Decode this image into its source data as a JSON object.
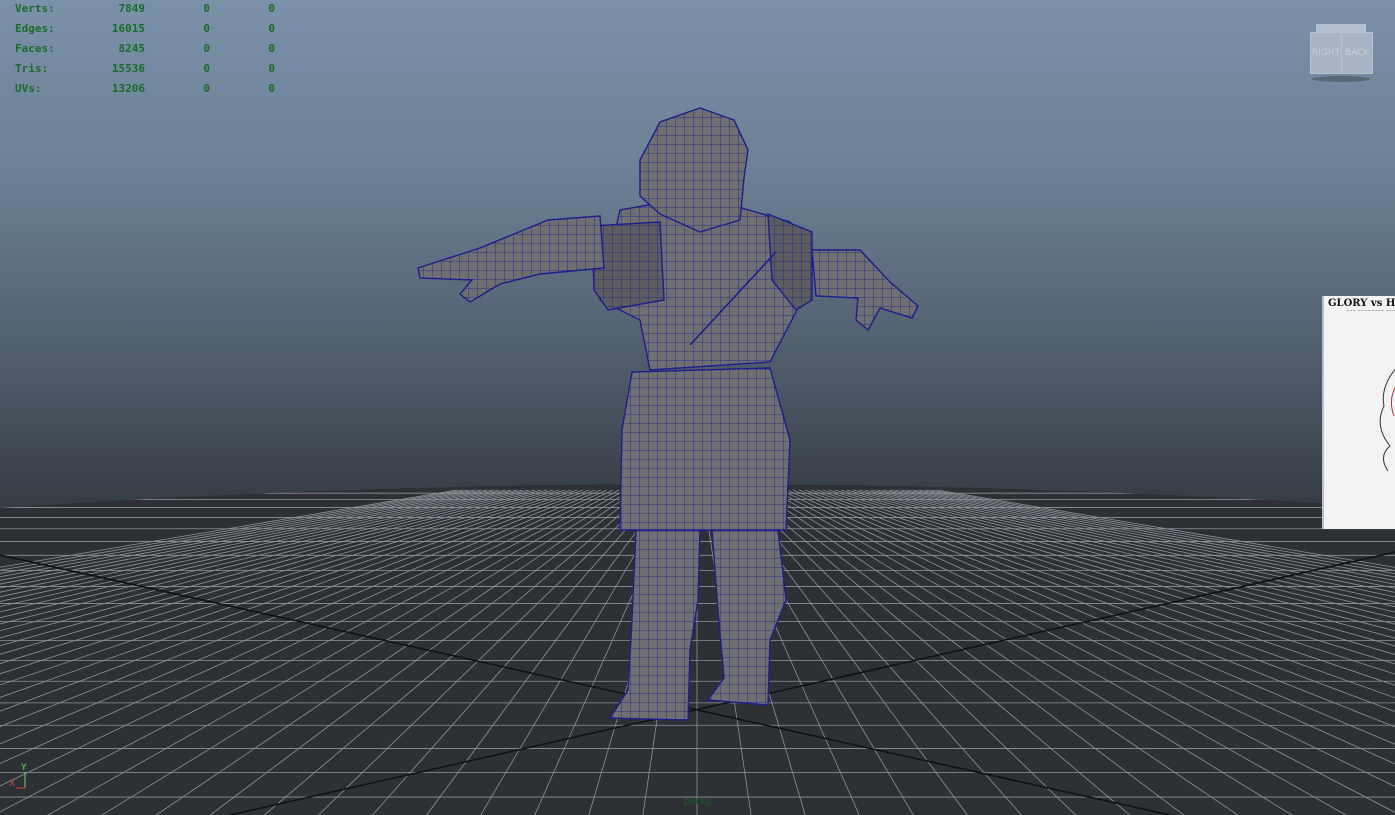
{
  "hud": {
    "rows": [
      {
        "label": "Verts:",
        "v1": "7849",
        "v2": "0",
        "v3": "0"
      },
      {
        "label": "Edges:",
        "v1": "16015",
        "v2": "0",
        "v3": "0"
      },
      {
        "label": "Faces:",
        "v1": "8245",
        "v2": "0",
        "v3": "0"
      },
      {
        "label": "Tris:",
        "v1": "15536",
        "v2": "0",
        "v3": "0"
      },
      {
        "label": "UVs:",
        "v1": "13206",
        "v2": "0",
        "v3": "0"
      }
    ]
  },
  "viewcube": {
    "right_label": "RIGHT",
    "back_label": "BACK"
  },
  "image_plane": {
    "title": "GLORY vs HUN",
    "subtitle": "~~~ ~~~~~~~~ ~~~"
  },
  "camera": {
    "name": "persp"
  },
  "axis": {
    "y_label": "Y",
    "x_label": "X"
  },
  "colors": {
    "hud_text": "#1a6b2a",
    "wireframe": "#1c1e8c",
    "mesh_fill": "#6e6e70",
    "grid_line": "#8f949a",
    "grid_axis": "#111111",
    "axis_y": "#6dd66d",
    "axis_x": "#d33a3a"
  }
}
